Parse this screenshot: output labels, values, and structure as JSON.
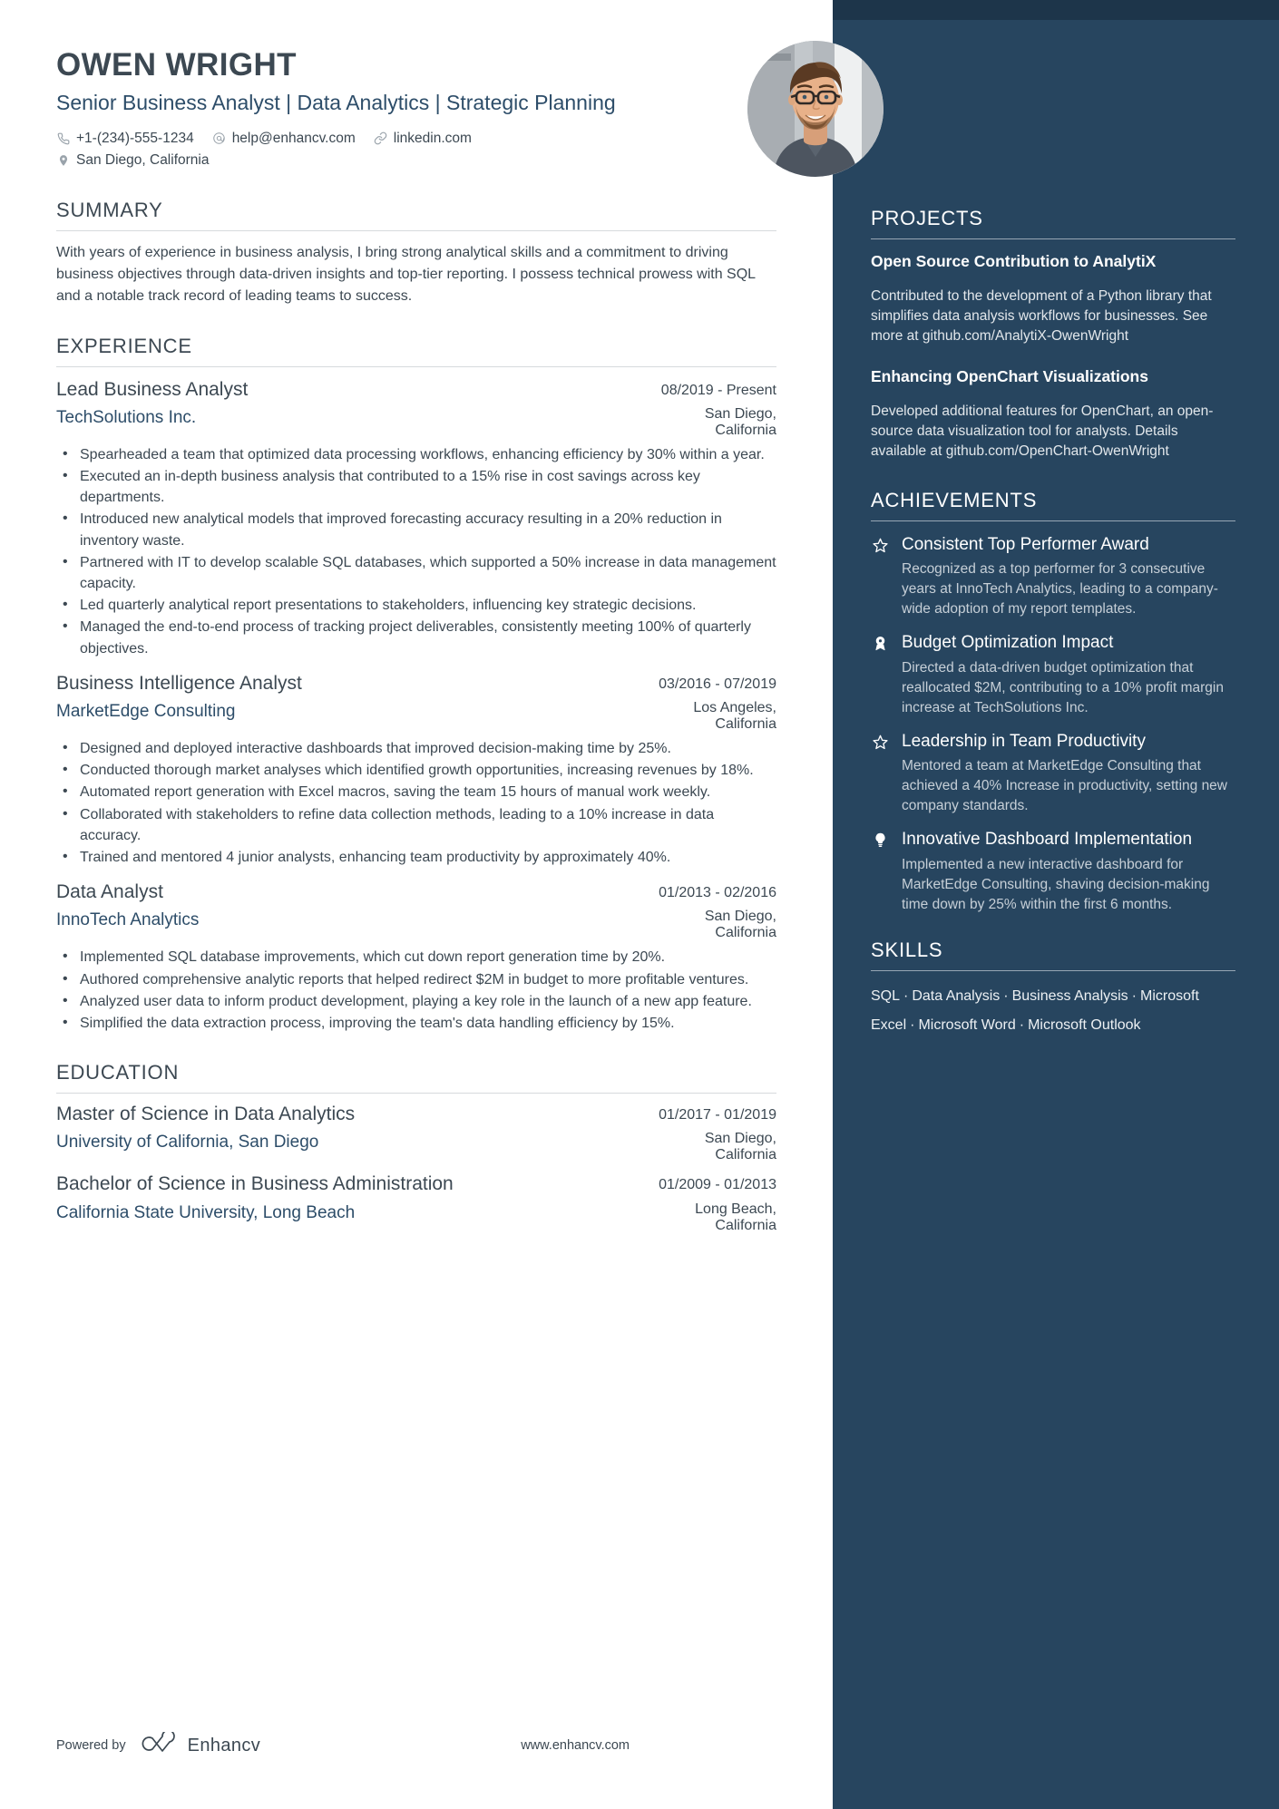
{
  "header": {
    "name": "OWEN WRIGHT",
    "headline": "Senior Business Analyst | Data Analytics | Strategic Planning",
    "contacts": [
      {
        "icon": "phone-icon",
        "text": "+1-(234)-555-1234"
      },
      {
        "icon": "email-icon",
        "text": "help@enhancv.com"
      },
      {
        "icon": "link-icon",
        "text": "linkedin.com"
      }
    ],
    "location": {
      "icon": "location-pin-icon",
      "text": "San Diego, California"
    }
  },
  "summary": {
    "title": "SUMMARY",
    "text": "With years of experience in business analysis, I bring strong analytical skills and a commitment to driving business objectives through data-driven insights and top-tier reporting. I possess technical prowess with SQL and a notable track record of leading teams to success."
  },
  "experience": {
    "title": "EXPERIENCE",
    "jobs": [
      {
        "title": "Lead Business Analyst",
        "date": "08/2019 - Present",
        "company": "TechSolutions Inc.",
        "location": "San Diego, California",
        "bullets": [
          "Spearheaded a team that optimized data processing workflows, enhancing efficiency by 30% within a year.",
          "Executed an in-depth business analysis that contributed to a 15% rise in cost savings across key departments.",
          "Introduced new analytical models that improved forecasting accuracy resulting in a 20% reduction in inventory waste.",
          "Partnered with IT to develop scalable SQL databases, which supported a 50% increase in data management capacity.",
          "Led quarterly analytical report presentations to stakeholders, influencing key strategic decisions.",
          "Managed the end-to-end process of tracking project deliverables, consistently meeting 100% of quarterly objectives."
        ]
      },
      {
        "title": "Business Intelligence Analyst",
        "date": "03/2016 - 07/2019",
        "company": "MarketEdge Consulting",
        "location": "Los Angeles, California",
        "bullets": [
          "Designed and deployed interactive dashboards that improved decision-making time by 25%.",
          "Conducted thorough market analyses which identified growth opportunities, increasing revenues by 18%.",
          "Automated report generation with Excel macros, saving the team 15 hours of manual work weekly.",
          "Collaborated with stakeholders to refine data collection methods, leading to a 10% increase in data accuracy.",
          "Trained and mentored 4 junior analysts, enhancing team productivity by approximately 40%."
        ]
      },
      {
        "title": "Data Analyst",
        "date": "01/2013 - 02/2016",
        "company": "InnoTech Analytics",
        "location": "San Diego, California",
        "bullets": [
          "Implemented SQL database improvements, which cut down report generation time by 20%.",
          "Authored comprehensive analytic reports that helped redirect $2M in budget to more profitable ventures.",
          "Analyzed user data to inform product development, playing a key role in the launch of a new app feature.",
          "Simplified the data extraction process, improving the team's data handling efficiency by 15%."
        ]
      }
    ]
  },
  "education": {
    "title": "EDUCATION",
    "items": [
      {
        "degree": "Master of Science in Data Analytics",
        "date": "01/2017 - 01/2019",
        "school": "University of California, San Diego",
        "location": "San Diego, California"
      },
      {
        "degree": "Bachelor of Science in Business Administration",
        "date": "01/2009 - 01/2013",
        "school": "California State University, Long Beach",
        "location": "Long Beach, California"
      }
    ]
  },
  "projects": {
    "title": "PROJECTS",
    "items": [
      {
        "title": "Open Source Contribution to AnalytiX",
        "description": "Contributed to the development of a Python library that simplifies data analysis workflows for businesses. See more at github.com/AnalytiX-OwenWright"
      },
      {
        "title": "Enhancing OpenChart Visualizations",
        "description": "Developed additional features for OpenChart, an open-source data visualization tool for analysts. Details available at github.com/OpenChart-OwenWright"
      }
    ]
  },
  "achievements": {
    "title": "ACHIEVEMENTS",
    "items": [
      {
        "icon": "star-icon",
        "title": "Consistent Top Performer Award",
        "description": "Recognized as a top performer for 3 consecutive years at InnoTech Analytics, leading to a company-wide adoption of my report templates."
      },
      {
        "icon": "award-medal-icon",
        "title": "Budget Optimization Impact",
        "description": "Directed a data-driven budget optimization that reallocated $2M, contributing to a 10% profit margin increase at TechSolutions Inc."
      },
      {
        "icon": "star-icon",
        "title": "Leadership in Team Productivity",
        "description": "Mentored a team at MarketEdge Consulting that achieved a 40% Increase in productivity, setting new company standards."
      },
      {
        "icon": "lightbulb-icon",
        "title": "Innovative Dashboard Implementation",
        "description": "Implemented a new interactive dashboard for MarketEdge Consulting, shaving decision-making time down by 25% within the first 6 months."
      }
    ]
  },
  "skills": {
    "title": "SKILLS",
    "items": [
      "SQL",
      "Data Analysis",
      "Business Analysis",
      "Microsoft Excel",
      "Microsoft Word",
      "Microsoft Outlook"
    ],
    "separator": "·"
  },
  "footer": {
    "powered_by": "Powered by",
    "brand": "Enhancv",
    "website": "www.enhancv.com"
  },
  "colors": {
    "sidebar_bg": "#27455f",
    "sidebar_top_strip": "#1d354a",
    "accent_blue": "#2d4d69",
    "body_text": "#3c4852"
  }
}
